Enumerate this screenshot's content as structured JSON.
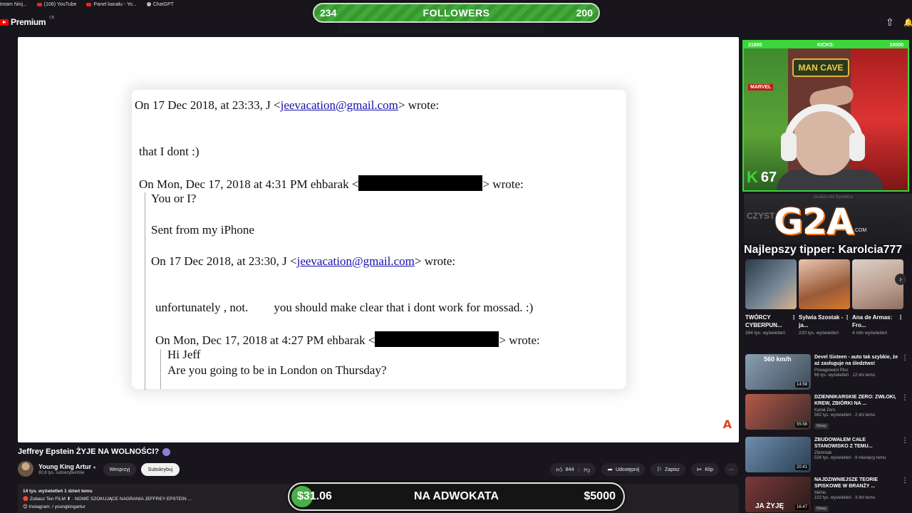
{
  "bookmarks": [
    {
      "label": "tream Ninj...",
      "icon": "none"
    },
    {
      "label": "(106) YouTube",
      "icon": "youtube-icon"
    },
    {
      "label": "Panel kanału - Yo...",
      "icon": "youtube-icon"
    },
    {
      "label": "ChatGPT",
      "icon": "chatgpt-icon"
    }
  ],
  "header": {
    "logo_text": "Premium",
    "logo_sup": "CB"
  },
  "followers_bar": {
    "left": "234",
    "label": "FOLLOWERS",
    "right": "200"
  },
  "document": {
    "line1_pre": "On 17 Dec 2018, at 23:33, J <",
    "line1_link": "jeevacation@gmail.com",
    "line1_post": "> wrote:",
    "line2": "that I dont  :)",
    "line3_pre": "On Mon, Dec 17, 2018 at 4:31 PM ehbarak <",
    "line3_post": "> wrote:",
    "line4": "You or I?",
    "line5": "Sent from my iPhone",
    "line6_pre": "On 17 Dec 2018, at 23:30, J <",
    "line6_link": "jeevacation@gmail.com",
    "line6_post": "> wrote:",
    "line7a": "unfortunately , not.",
    "line7b": "you should make clear that i dont work for mossad. :)",
    "line8_pre": "On Mon, Dec 17, 2018 at 4:27 PM ehbarak <",
    "line8_post": "> wrote:",
    "line9": "Hi Jeff",
    "line10": "Are you going to be in London on Thursday?"
  },
  "video": {
    "title": "Jeffrey Epstein ŻYJE NA WOLNOŚCI?",
    "channel_name": "Young King Artur",
    "channel_subs": "80,8 tys. subskrybentów",
    "join_label": "Wesprzyj",
    "subscribe_label": "Subskrybuj",
    "likes": "844",
    "share_label": "Udostępnij",
    "save_label": "Zapisz",
    "clip_label": "Klip",
    "desc_stats": "14 tys. wyświetleń  1 dzień temu",
    "desc_line1": "Zobacz Ten FILM  ⬆  · NOWE SZOKUJĄCE NAGRANIA JEFFREY EPSTEIN  ...",
    "desc_line2": "Instagram:  / youngkingartur"
  },
  "donation": {
    "current": "$31.06",
    "label": "NA ADWOKATA",
    "goal": "$5000",
    "progress": 0.0062
  },
  "webcam": {
    "left_count": "21800",
    "label": "KICKS:",
    "right_count": "10000",
    "sign": "MAN CAVE",
    "marvel": "MARVEL",
    "kick_count": "67"
  },
  "sidebar": {
    "ghost_title": "Analiza Akt Epsteina",
    "ghost_word": "CZYST",
    "sponsor": "G2A",
    "sponsor_suffix": ".COM",
    "tipper": "Najlepszy tipper: Karolcia777",
    "shorts": [
      {
        "title": "TWÓRCY CYBERPUN...",
        "views": "394 tys. wyświetleń",
        "color": "#4a5b6a"
      },
      {
        "title": "Sylwia Szostak - ja...",
        "views": "220 tys. wyświetleń",
        "color": "#9a6a4a"
      },
      {
        "title": "Ana de Armas: Fro...",
        "views": "4 mln wyświetleń",
        "color": "#b99c8c"
      }
    ],
    "recs": [
      {
        "title": "Devel Sixteen - auto tak szybkie, że aż zasługuje na śledztwo!",
        "channel": "Powagowani Plus",
        "views": "66 tys. wyświetleń · 12 dni temu",
        "duration": "14:58",
        "thumb_text": "560 km/h",
        "color": "#6b7f90",
        "badge": ""
      },
      {
        "title": "DZIENNIKARSKIE ZERO: ZWŁOKI, KREW, ZBIÓRKI NA ...",
        "channel": "Kanał Zero",
        "views": "562 tys. wyświetleń · 2 dni temu",
        "duration": "55:58",
        "thumb_text": "",
        "color": "#8a3c34",
        "badge": "Nowy"
      },
      {
        "title": "ZBUDOWAŁEM CAŁE STANOWISKO Z TEMU...",
        "channel": "Zlemniak",
        "views": "534 tys. wyświetleń · 8 miesięcy temu",
        "duration": "20:41",
        "thumb_text": "",
        "color": "#4d6e8e",
        "badge": ""
      },
      {
        "title": "NAJDZIWNIEJSZE TEORIE SPISKOWE W BRANŻY ...",
        "channel": "Mehio",
        "views": "102 tys. wyświetleń · 3 dni temu",
        "duration": "16:47",
        "thumb_text": "JA ŻYJĘ",
        "color": "#5a2b2b",
        "badge": "Nowy"
      }
    ]
  },
  "colors": {
    "accent_green": "#3bd63b",
    "youtube_red": "#ff0000",
    "link_blue": "#1a0dab"
  }
}
